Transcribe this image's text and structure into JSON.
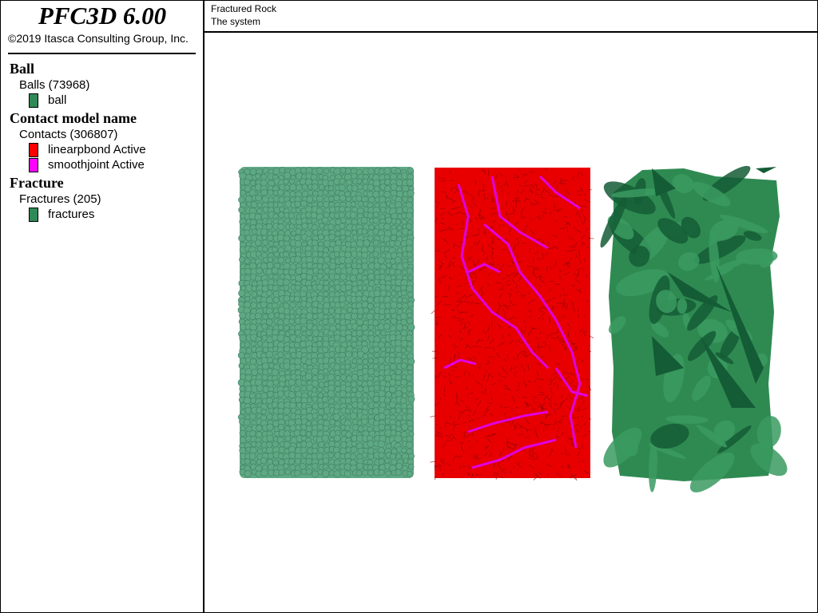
{
  "app": {
    "title": "PFC3D 6.00",
    "copyright": "©2019 Itasca Consulting Group, Inc."
  },
  "header": {
    "line1": "Fractured Rock",
    "line2": "The system"
  },
  "legend": {
    "ball": {
      "title": "Ball",
      "group": "Balls (73968)",
      "items": [
        {
          "label": "ball",
          "color": "#2e8b57"
        }
      ]
    },
    "contact": {
      "title": "Contact model name",
      "group": "Contacts (306807)",
      "items": [
        {
          "label": "linearpbond Active",
          "color": "#ff0000"
        },
        {
          "label": "smoothjoint Active",
          "color": "#ff00ff"
        }
      ]
    },
    "fracture": {
      "title": "Fracture",
      "group": "Fractures (205)",
      "items": [
        {
          "label": "fractures",
          "color": "#2e8b57"
        }
      ]
    }
  },
  "colors": {
    "ball_fill": "#5fa884",
    "ball_edge": "#3f7f61",
    "contact_red": "#e80000",
    "contact_magenta": "#e000e0",
    "fracture_light": "#2f8a52",
    "fracture_dark": "#145c35"
  }
}
